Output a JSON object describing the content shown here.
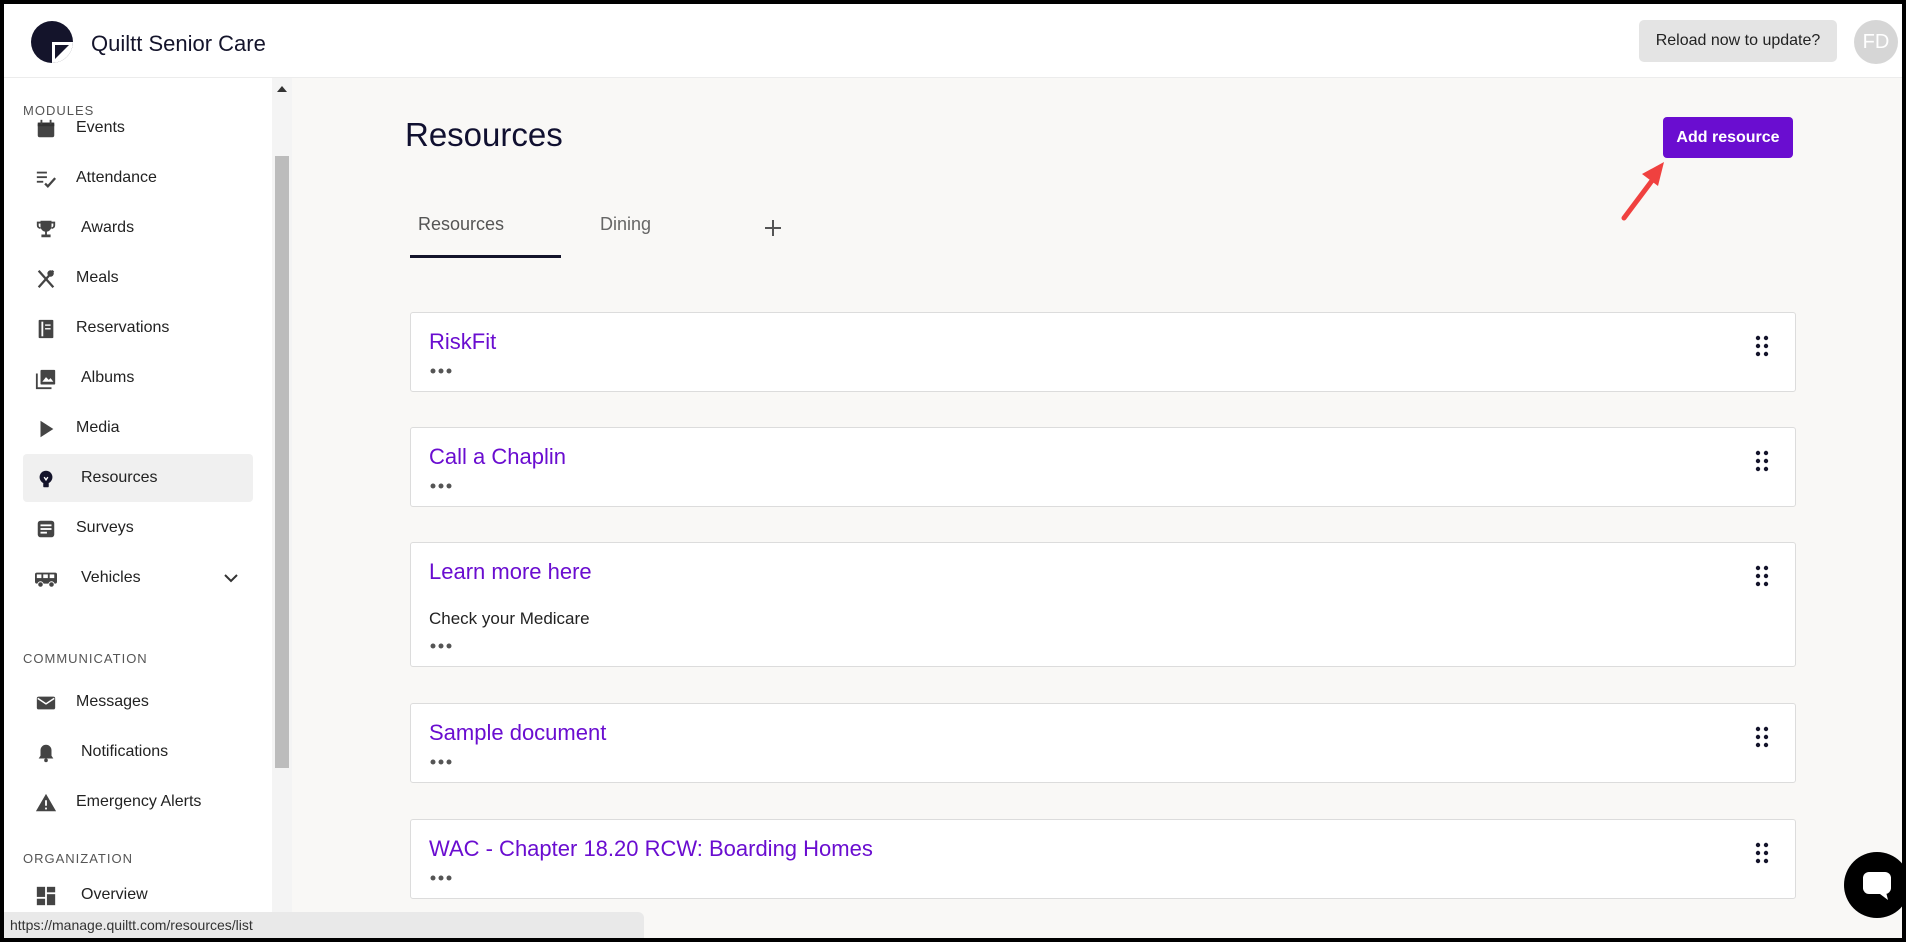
{
  "header": {
    "app_title": "Quiltt Senior Care",
    "reload_label": "Reload now to update?",
    "avatar_initials": "FD"
  },
  "sidebar": {
    "sections": {
      "modules": "MODULES",
      "communication": "COMMUNICATION",
      "organization": "ORGANIZATION"
    },
    "items": [
      {
        "label": "Events",
        "icon": "calendar-icon"
      },
      {
        "label": "Attendance",
        "icon": "checklist-icon"
      },
      {
        "label": "Awards",
        "icon": "trophy-icon"
      },
      {
        "label": "Meals",
        "icon": "utensils-icon"
      },
      {
        "label": "Reservations",
        "icon": "book-icon"
      },
      {
        "label": "Albums",
        "icon": "photos-icon"
      },
      {
        "label": "Media",
        "icon": "play-icon"
      },
      {
        "label": "Resources",
        "icon": "lightbulb-icon",
        "active": true
      },
      {
        "label": "Surveys",
        "icon": "survey-icon"
      },
      {
        "label": "Vehicles",
        "icon": "bus-icon",
        "expandable": true
      },
      {
        "label": "Messages",
        "icon": "mail-icon"
      },
      {
        "label": "Notifications",
        "icon": "bell-icon"
      },
      {
        "label": "Emergency Alerts",
        "icon": "warning-icon"
      },
      {
        "label": "Overview",
        "icon": "dashboard-icon"
      }
    ]
  },
  "main": {
    "title": "Resources",
    "add_button": "Add resource",
    "tabs": [
      {
        "label": "Resources",
        "active": true
      },
      {
        "label": "Dining",
        "active": false
      }
    ],
    "resources": [
      {
        "title": "RiskFit",
        "description": ""
      },
      {
        "title": "Call a Chaplin",
        "description": ""
      },
      {
        "title": "Learn more here",
        "description": "Check your Medicare"
      },
      {
        "title": "Sample document",
        "description": ""
      },
      {
        "title": "WAC - Chapter 18.20 RCW: Boarding Homes",
        "description": ""
      }
    ]
  },
  "status_bar": {
    "url": "https://manage.quiltt.com/resources/list"
  },
  "colors": {
    "accent": "#6a0dd0",
    "arrow": "#f0413f",
    "navy": "#14142b"
  }
}
